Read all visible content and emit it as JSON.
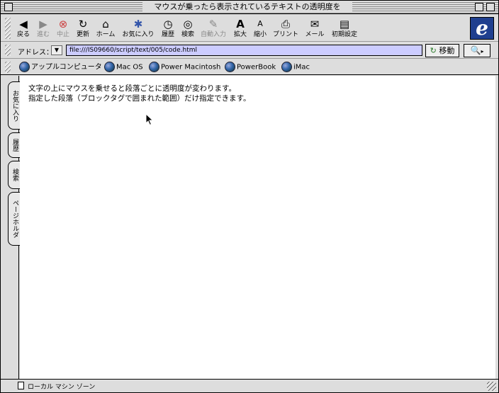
{
  "window": {
    "title": "マウスが乗ったら表示されているテキストの透明度を"
  },
  "toolbar": {
    "buttons": [
      {
        "label": "戻る",
        "icon": "back-arrow-icon",
        "glyph": "◀"
      },
      {
        "label": "進む",
        "icon": "forward-arrow-icon",
        "glyph": "▶"
      },
      {
        "label": "中止",
        "icon": "stop-icon",
        "glyph": "⊗"
      },
      {
        "label": "更新",
        "icon": "refresh-icon",
        "glyph": "↻"
      },
      {
        "label": "ホーム",
        "icon": "home-icon",
        "glyph": "⌂"
      },
      {
        "label": "お気に入り",
        "icon": "favorites-icon",
        "glyph": "✱"
      },
      {
        "label": "履歴",
        "icon": "history-clock-icon",
        "glyph": "◷"
      },
      {
        "label": "検索",
        "icon": "search-magnifier-icon",
        "glyph": "◎"
      },
      {
        "label": "自動入力",
        "icon": "autofill-pencil-icon",
        "glyph": "✎"
      },
      {
        "label": "拡大",
        "icon": "text-larger-icon",
        "glyph": "A"
      },
      {
        "label": "縮小",
        "icon": "text-smaller-icon",
        "glyph": "A"
      },
      {
        "label": "プリント",
        "icon": "printer-icon",
        "glyph": "⎙"
      },
      {
        "label": "メール",
        "icon": "mail-icon",
        "glyph": "✉"
      },
      {
        "label": "初期設定",
        "icon": "preferences-icon",
        "glyph": "▤"
      }
    ]
  },
  "address": {
    "label": "アドレス：",
    "url": "file:///IS09660/script/text/005/code.html",
    "go_label": "移動",
    "go_glyph": "↻"
  },
  "favorites_bar": {
    "items": [
      "アップルコンピュータ",
      "Mac OS",
      "Power Macintosh",
      "PowerBook",
      "iMac"
    ]
  },
  "side_tabs": [
    "お気に入り",
    "履歴",
    "検索",
    "ページホルダ"
  ],
  "content": {
    "lines": [
      "文字の上にマウスを乗せると段落ごとに透明度が変わります。",
      "指定した段落（ブロックタグで囲まれた範囲）だけ指定できます。"
    ]
  },
  "status": {
    "text": "ローカル マシン ゾーン"
  },
  "colors": {
    "chrome": "#dddddd",
    "address_field": "#ccccff",
    "ie_logo": "#1f3f8f"
  }
}
